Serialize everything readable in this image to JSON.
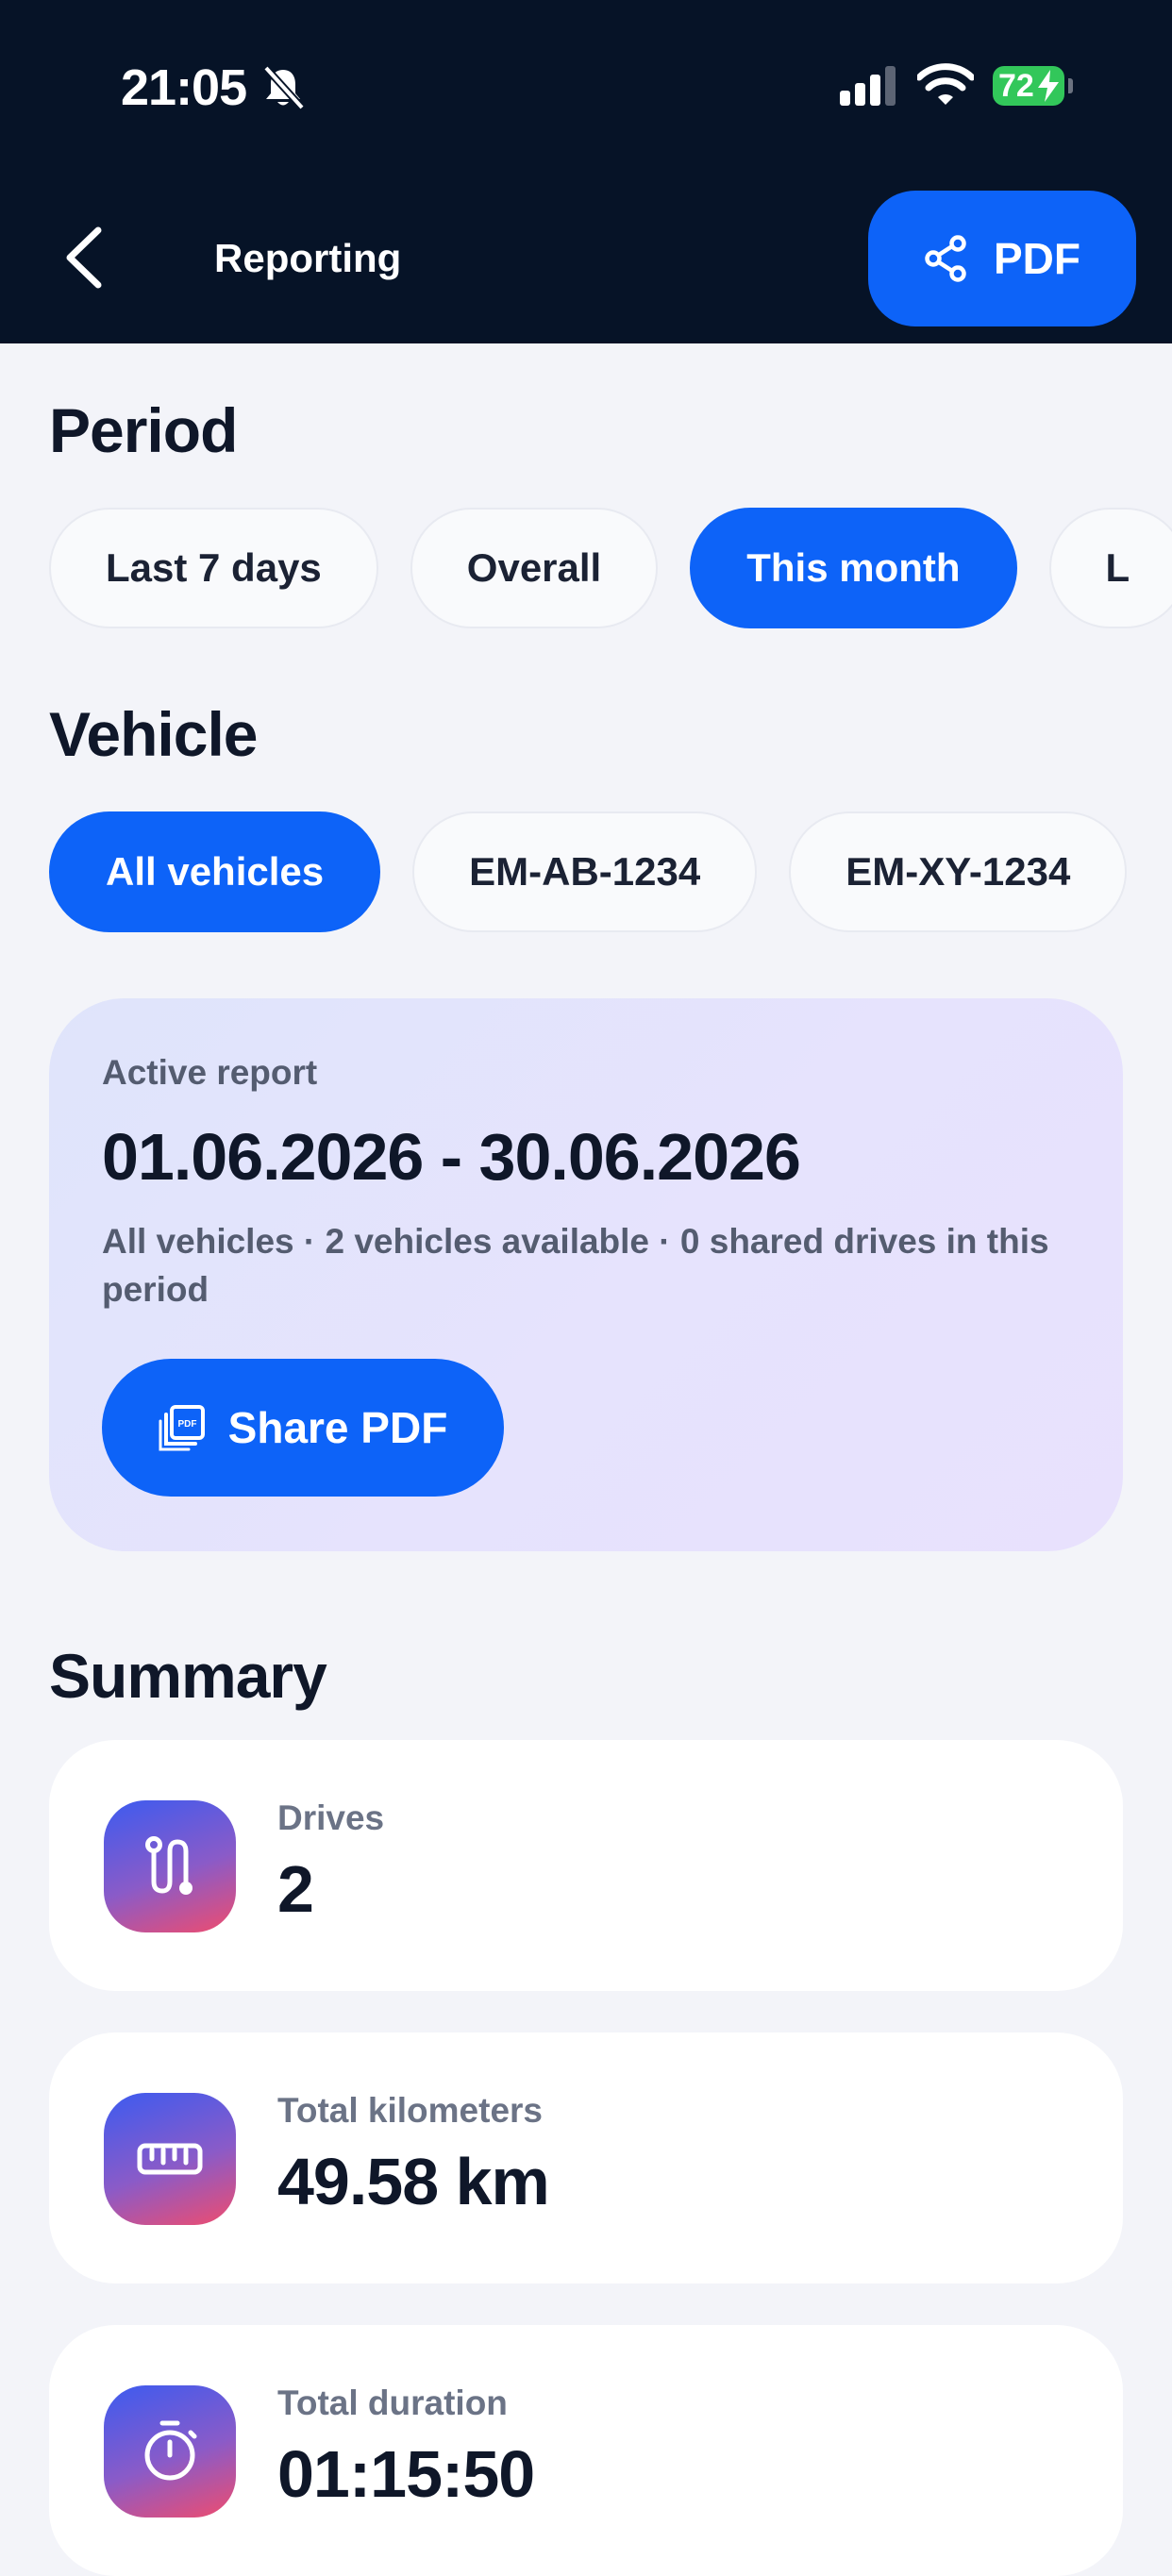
{
  "status_bar": {
    "time": "21:05",
    "battery": "72"
  },
  "header": {
    "title": "Reporting",
    "pdf_label": "PDF"
  },
  "period": {
    "title": "Period",
    "chips": [
      "Last 7 days",
      "Overall",
      "This month",
      "L"
    ],
    "selected": "This month"
  },
  "vehicle": {
    "title": "Vehicle",
    "chips": [
      "All vehicles",
      "EM-AB-1234",
      "EM-XY-1234"
    ],
    "selected": "All vehicles"
  },
  "active_report": {
    "label": "Active report",
    "range": "01.06.2026 - 30.06.2026",
    "description": "All vehicles · 2 vehicles available · 0 shared drives in this period",
    "share_label": "Share PDF"
  },
  "summary": {
    "title": "Summary",
    "stats": [
      {
        "label": "Drives",
        "value": "2",
        "icon": "route-icon"
      },
      {
        "label": "Total kilometers",
        "value": "49.58 km",
        "icon": "ruler-icon"
      },
      {
        "label": "Total duration",
        "value": "01:15:50",
        "icon": "stopwatch-icon"
      }
    ]
  },
  "colors": {
    "header_bg": "#061327",
    "accent": "#0d63f8",
    "page_bg": "#f3f4f9",
    "battery": "#32c75a"
  }
}
